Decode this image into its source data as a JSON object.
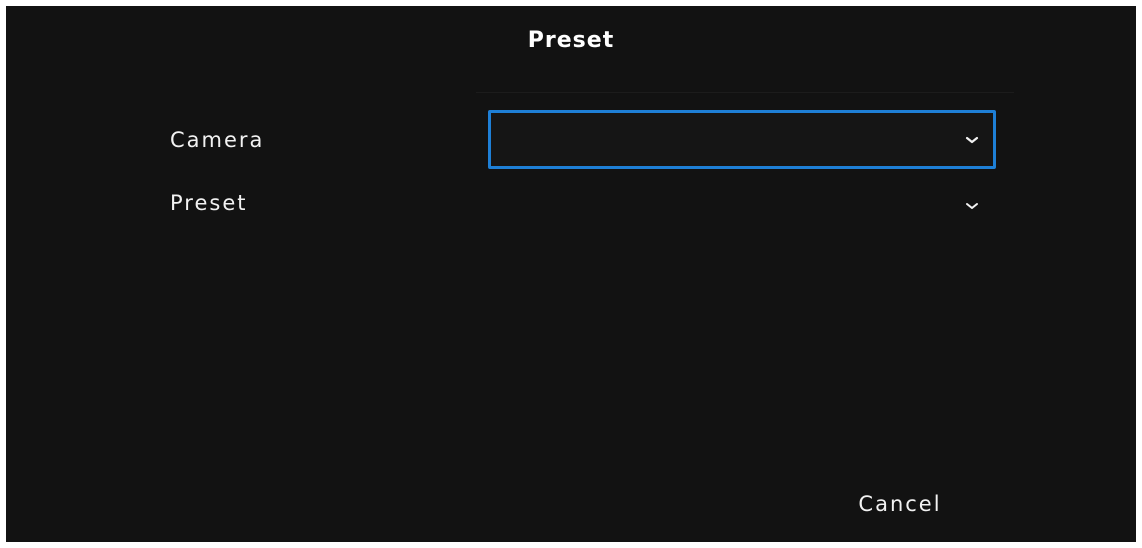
{
  "dialog": {
    "title": "Preset",
    "fields": {
      "camera": {
        "label": "Camera",
        "value": "",
        "icon": "chevron-down-icon"
      },
      "preset": {
        "label": "Preset",
        "value": "",
        "icon": "chevron-down-icon"
      }
    },
    "buttons": {
      "cancel_label": "Cancel"
    }
  },
  "colors": {
    "background": "#121212",
    "text": "#f2f2f2",
    "focus_border": "#1e7fd6"
  }
}
